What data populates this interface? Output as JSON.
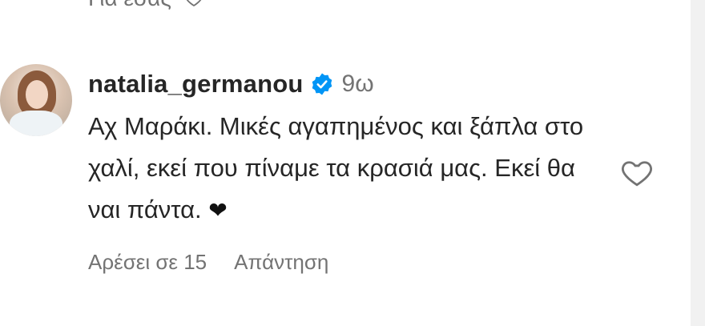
{
  "previous_comment": {
    "text_fragment": "Για εσάς"
  },
  "comment": {
    "username": "natalia_germanou",
    "verified_icon": "verified-badge-icon",
    "time_ago": "9ω",
    "text": "Αχ Μαράκι. Μικές αγαπημένος και ξάπλα στο χαλί, εκεί που πίναμε τα κρασιά μας. Εκεί θα ναι πάντα.",
    "emoji": "❤",
    "likes_label": "Αρέσει σε 15",
    "reply_label": "Απάντηση"
  },
  "colors": {
    "text_primary": "#262626",
    "text_secondary": "#737373",
    "verified_blue": "#0095f6"
  }
}
